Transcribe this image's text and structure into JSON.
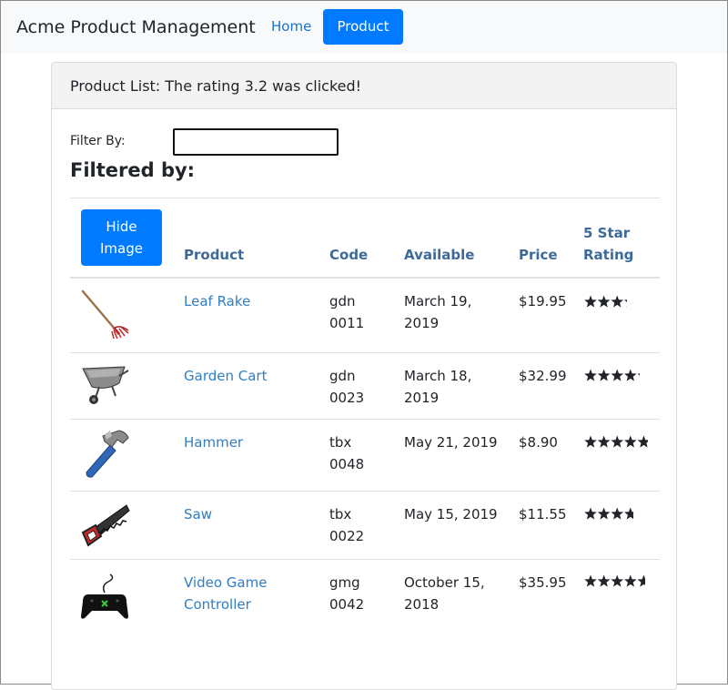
{
  "navbar": {
    "brand": "Acme Product Management",
    "home_label": "Home",
    "product_label": "Product"
  },
  "card": {
    "header": "Product List: The rating 3.2 was clicked!"
  },
  "filter": {
    "label": "Filter By:",
    "value": "",
    "filtered_by": "Filtered by:"
  },
  "table": {
    "hide_image_label_1": "Hide",
    "hide_image_label_2": "Image",
    "headers": {
      "product": "Product",
      "code": "Code",
      "available": "Available",
      "price": "Price",
      "rating_1": "5 Star",
      "rating_2": "Rating"
    },
    "rows": [
      {
        "name_1": "Leaf Rake",
        "name_2": "",
        "code_1": "gdn",
        "code_2": "0011",
        "available_1": "March 19,",
        "available_2": "2019",
        "price": "$19.95",
        "rating": 3.2,
        "image": "leaf-rake-image"
      },
      {
        "name_1": "Garden Cart",
        "name_2": "",
        "code_1": "gdn",
        "code_2": "0023",
        "available_1": "March 18,",
        "available_2": "2019",
        "price": "$32.99",
        "rating": 4.2,
        "image": "garden-cart-image"
      },
      {
        "name_1": "Hammer",
        "name_2": "",
        "code_1": "tbx",
        "code_2": "0048",
        "available_1": "May 21, 2019",
        "available_2": "",
        "price": "$8.90",
        "rating": 4.8,
        "image": "hammer-image"
      },
      {
        "name_1": "Saw",
        "name_2": "",
        "code_1": "tbx",
        "code_2": "0022",
        "available_1": "May 15, 2019",
        "available_2": "",
        "price": "$11.55",
        "rating": 3.7,
        "image": "saw-image"
      },
      {
        "name_1": "Video Game",
        "name_2": "Controller",
        "code_1": "gmg",
        "code_2": "0042",
        "available_1": "October 15,",
        "available_2": "2018",
        "price": "$35.95",
        "rating": 4.6,
        "image": "game-controller-image"
      }
    ]
  },
  "colors": {
    "primary": "#007bff",
    "link": "#2f7ec4",
    "header_link": "#3d6a99",
    "navbar_bg": "#f8f9fa"
  }
}
